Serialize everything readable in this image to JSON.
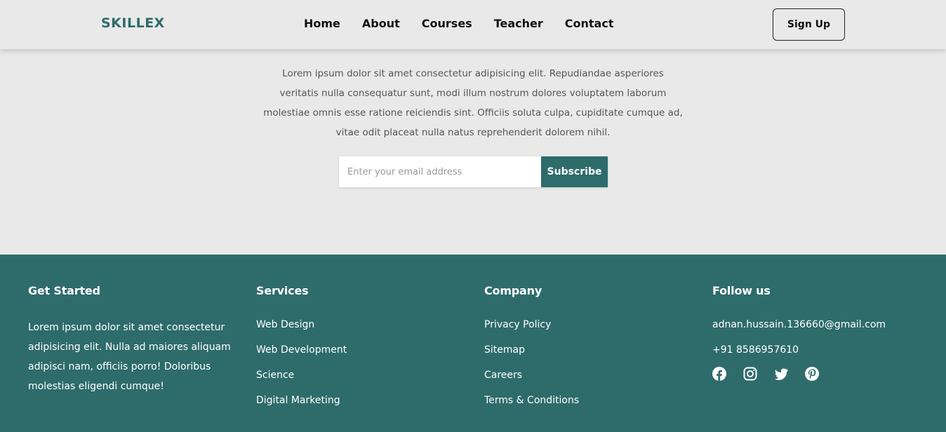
{
  "navbar": {
    "logo": "SKILLEX",
    "links": [
      "Home",
      "About",
      "Courses",
      "Teacher",
      "Contact"
    ],
    "signup_label": "Sign Up"
  },
  "hero": {
    "text": "Lorem ipsum dolor sit amet consectetur adipisicing elit. Repudiandae asperiores veritatis nulla consequatur sunt, modi illum nostrum dolores voluptatem laborum molestiae omnis esse ratione reiciendis sint. Officiis soluta culpa, cupiditate cumque ad, vitae odit placeat nulla natus reprehenderit dolorem nihil."
  },
  "subscribe": {
    "placeholder": "Enter your email address",
    "value": "",
    "button_label": "Subscribe"
  },
  "footer": {
    "get_started": {
      "title": "Get Started",
      "text": "Lorem ipsum dolor sit amet consectetur adipisicing elit. Nulla ad maiores aliquam adipisci nam, officiis porro! Doloribus molestias eligendi cumque!"
    },
    "services": {
      "title": "Services",
      "links": [
        "Web Design",
        "Web Development",
        "Science",
        "Digital Marketing"
      ]
    },
    "company": {
      "title": "Company",
      "links": [
        "Privacy Policy",
        "Sitemap",
        "Careers",
        "Terms & Conditions"
      ]
    },
    "follow": {
      "title": "Follow us",
      "email": "adnan.hussain.136660@gmail.com",
      "phone": "+91 8586957610",
      "social_icons": [
        "facebook-icon",
        "instagram-icon",
        "twitter-icon",
        "pinterest-icon"
      ]
    }
  },
  "colors": {
    "background": "#e9e9e9",
    "accent": "#2e6b6b",
    "text": "#111111"
  }
}
